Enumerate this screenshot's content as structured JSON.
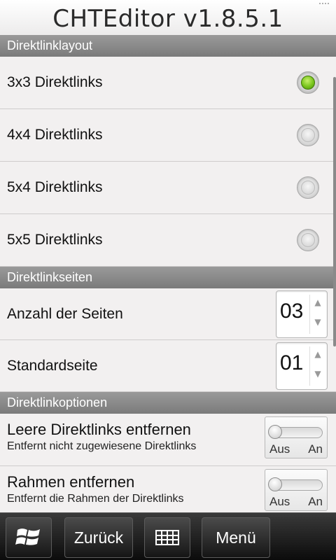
{
  "app": {
    "title": "CHTEditor v1.8.5.1"
  },
  "sections": {
    "layout_header": "Direktlinklayout",
    "pages_header": "Direktlinkseiten",
    "options_header": "Direktlinkoptionen"
  },
  "layout_options": [
    {
      "label": "3x3 Direktlinks",
      "selected": true
    },
    {
      "label": "4x4 Direktlinks",
      "selected": false
    },
    {
      "label": "5x4 Direktlinks",
      "selected": false
    },
    {
      "label": "5x5 Direktlinks",
      "selected": false
    }
  ],
  "pages": {
    "count_label": "Anzahl der Seiten",
    "count_value": "03",
    "default_label": "Standardseite",
    "default_value": "01"
  },
  "options": [
    {
      "title": "Leere Direktlinks entfernen",
      "subtitle": "Entfernt nicht zugewiesene Direktlinks",
      "off_label": "Aus",
      "on_label": "An",
      "state": "off"
    },
    {
      "title": "Rahmen entfernen",
      "subtitle": "Entfernt die Rahmen der Direktlinks",
      "off_label": "Aus",
      "on_label": "An",
      "state": "off"
    }
  ],
  "bottom_bar": {
    "windows_icon": "windows-logo-icon",
    "back_label": "Zurück",
    "keyboard_icon": "keyboard-icon",
    "menu_label": "Menü"
  },
  "colors": {
    "accent_green": "#78c41c",
    "section_header": "#8a8a8a"
  }
}
